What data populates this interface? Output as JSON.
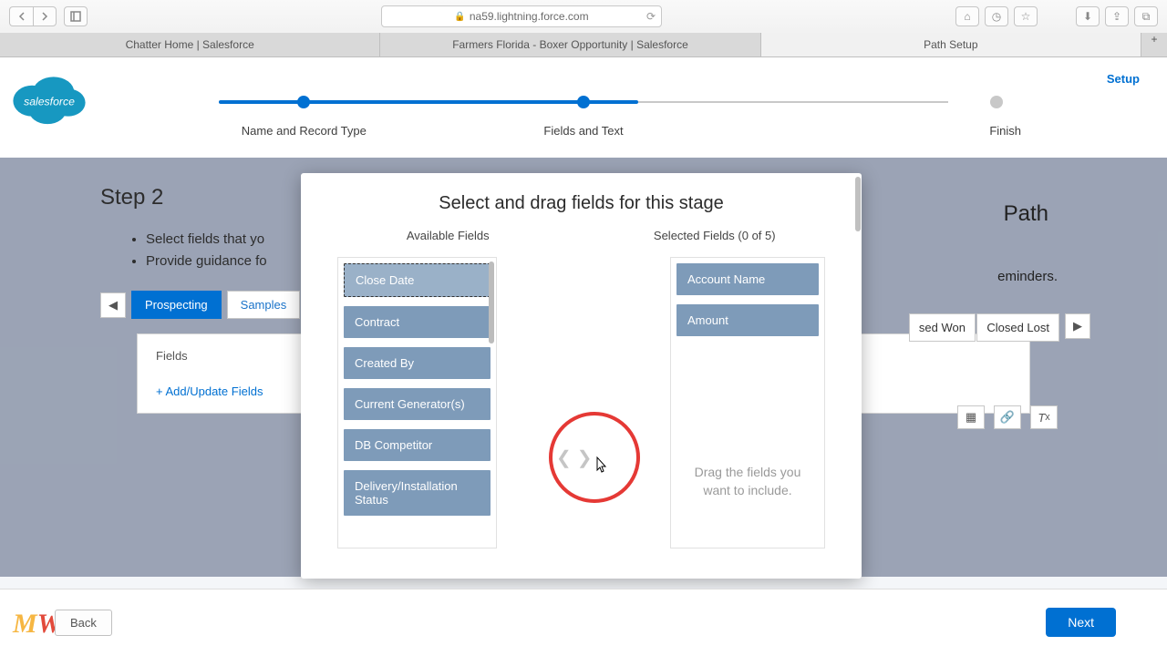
{
  "browser": {
    "url": "na59.lightning.force.com",
    "tabs": [
      "Chatter Home | Salesforce",
      "Farmers Florida - Boxer Opportunity | Salesforce",
      "Path Setup"
    ],
    "active_tab": 2
  },
  "app": {
    "logo_text": "salesforce",
    "setup_link": "Setup",
    "progress": {
      "steps": [
        "Name and Record Type",
        "Fields and Text",
        "Finish"
      ],
      "current": 1
    }
  },
  "background": {
    "heading_partial": "Step 2",
    "heading_trail": "Path",
    "bullets": [
      "Select fields that yo",
      "Provide guidance fo"
    ],
    "bullets_trail": "eminders.",
    "stages": {
      "active": "Prospecting",
      "next_partial": "Samples",
      "won_partial": "sed Won",
      "lost": "Closed Lost"
    },
    "card": {
      "fields_label": "Fields",
      "add_link": "+ Add/Update Fields"
    }
  },
  "modal": {
    "title": "Select and drag fields for this stage",
    "available_label": "Available Fields",
    "selected_label": "Selected Fields (0 of 5)",
    "available": [
      "Close Date",
      "Contract",
      "Created By",
      "Current Generator(s)",
      "DB Competitor",
      "Delivery/Installation Status"
    ],
    "selected": [
      "Account Name",
      "Amount"
    ],
    "drag_hint": "Drag the fields you want to include."
  },
  "footer": {
    "back": "Back",
    "next": "Next"
  },
  "watermark": {
    "a": "M",
    "b": "W",
    "c": "M"
  }
}
